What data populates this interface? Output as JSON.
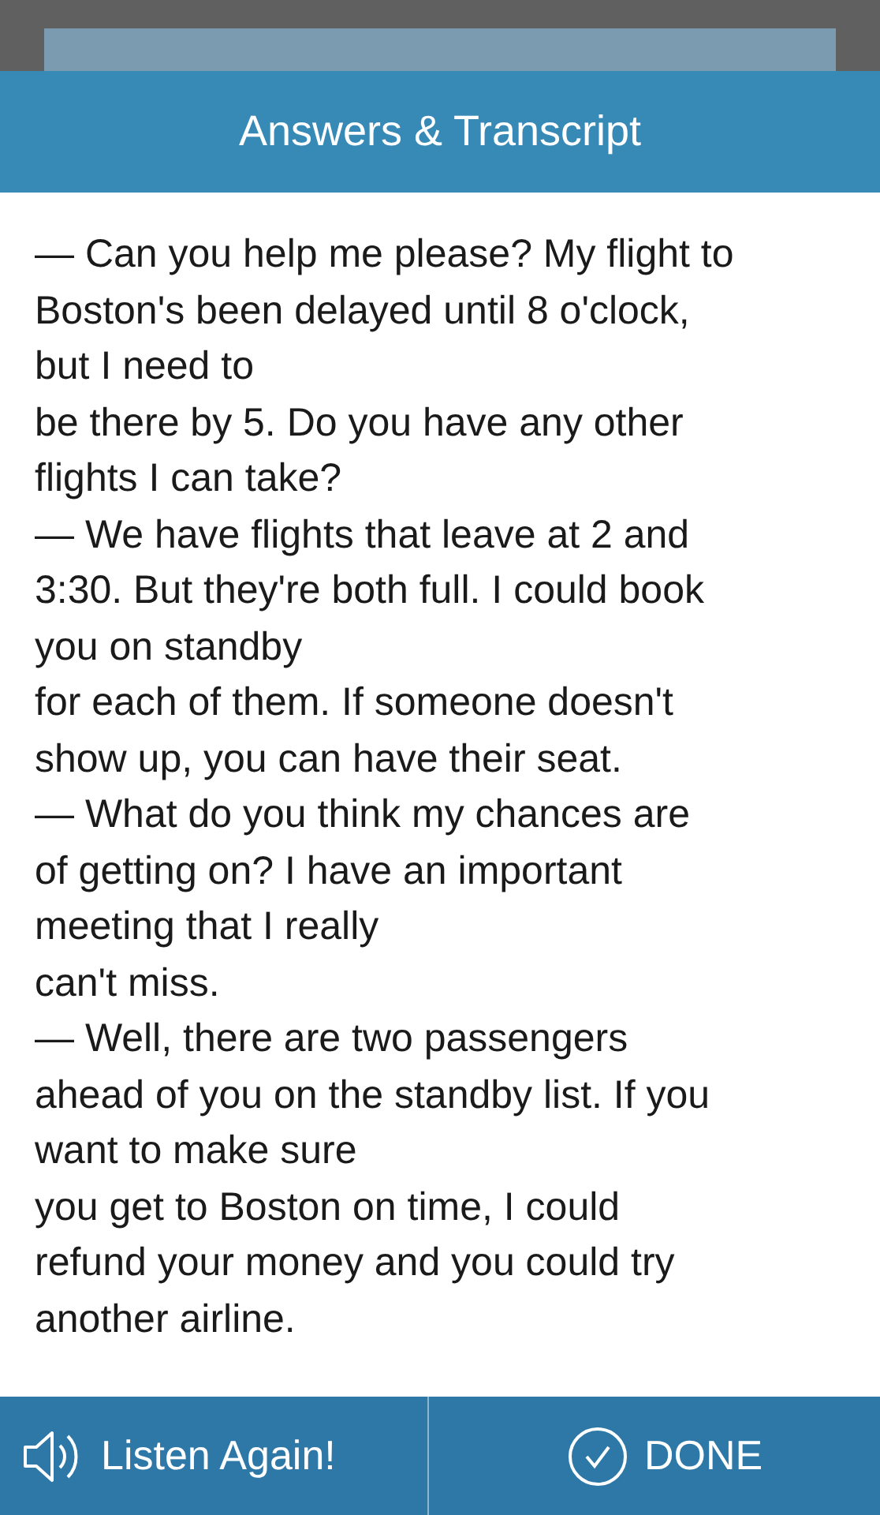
{
  "header": {
    "title": "Answers & Transcript"
  },
  "transcript": {
    "lines": [
      "— Can you help me please? My flight to",
      "Boston's been delayed until 8 o'clock,",
      "but I need to",
      "be there by 5. Do you have any other",
      "flights I can take?",
      "— We have flights that leave at 2 and",
      "3:30. But they're both full. I could book",
      "you on standby",
      "for each of them. If someone doesn't",
      "show up, you can have their seat.",
      "— What do you think my chances are",
      "of getting on? I have an important",
      "meeting that I really",
      "can't miss.",
      "— Well, there are two passengers",
      "ahead of you on the standby list. If you",
      "want to make sure",
      "you get to Boston on time, I could",
      "refund your money and you could try",
      "another airline."
    ]
  },
  "footer": {
    "buttons": [
      {
        "kind": "listen",
        "label": "Listen Again!"
      },
      {
        "kind": "done",
        "label": "DONE"
      }
    ]
  }
}
